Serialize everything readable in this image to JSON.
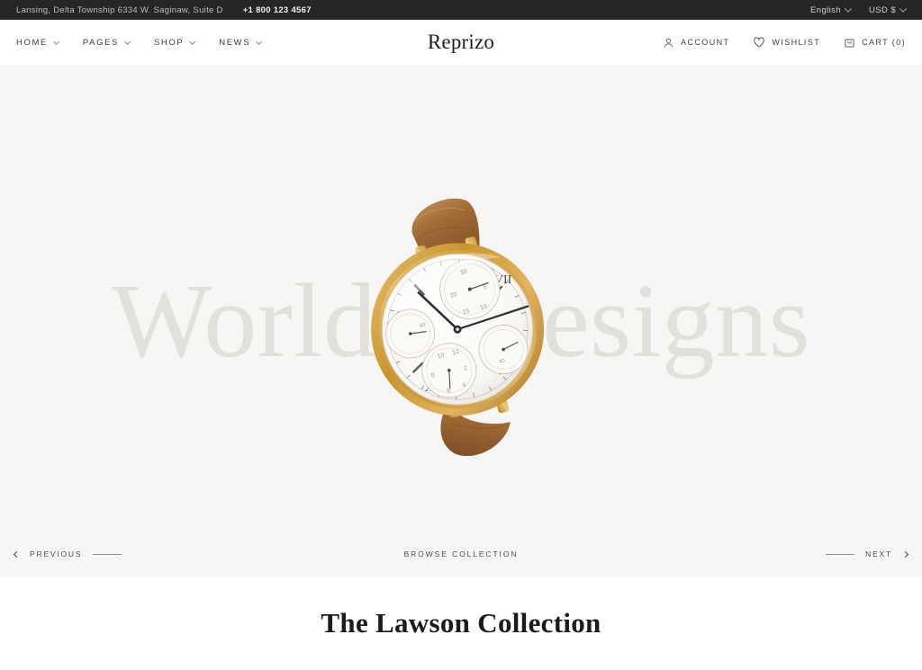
{
  "topbar": {
    "address": "Lansing, Delta Township 6334 W. Saginaw, Suite D",
    "phone": "+1 800 123 4567",
    "language": "English",
    "currency": "USD $"
  },
  "header": {
    "logo": "Reprizo",
    "nav": [
      {
        "label": "HOME",
        "has_dropdown": true
      },
      {
        "label": "PAGES",
        "has_dropdown": true
      },
      {
        "label": "SHOP",
        "has_dropdown": true
      },
      {
        "label": "NEWS",
        "has_dropdown": true
      }
    ],
    "actions": [
      {
        "label": "ACCOUNT",
        "icon": "user-icon"
      },
      {
        "label": "WISHLIST",
        "icon": "heart-icon"
      },
      {
        "label": "CART (0)",
        "icon": "bag-icon"
      }
    ]
  },
  "hero": {
    "watermark": "World's Designs",
    "product_alt": "gold chronograph wristwatch with brown leather strap",
    "previous_label": "PREVIOUS",
    "next_label": "NEXT",
    "browse_label": "BROWSE COLLECTION"
  },
  "collection": {
    "title": "The Lawson Collection"
  },
  "colors": {
    "topbar_bg": "#262626",
    "hero_bg": "#f7f6f4",
    "watermark": "#e2e0dd",
    "text_dark": "#1d1d1d",
    "gold": "#c9933f",
    "strap": "#a9713f"
  }
}
